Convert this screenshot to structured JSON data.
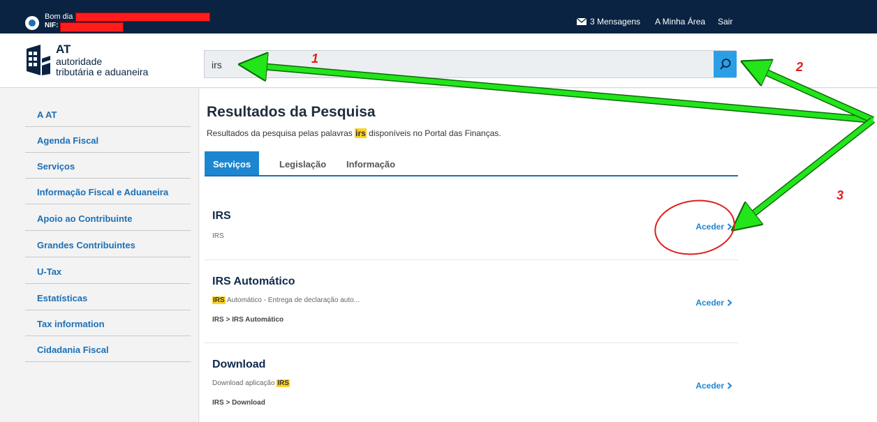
{
  "topbar": {
    "greeting": "Bom dia",
    "nif_label": "NIF:",
    "messages": "3 Mensagens",
    "my_area": "A Minha Área",
    "logout": "Sair"
  },
  "logo": {
    "acronym": "AT",
    "line1": "autoridade",
    "line2": "tributária e aduaneira"
  },
  "search": {
    "value": "irs",
    "icon": "search-icon"
  },
  "sidebar": {
    "items": [
      {
        "label": "A AT"
      },
      {
        "label": "Agenda Fiscal"
      },
      {
        "label": "Serviços"
      },
      {
        "label": "Informação Fiscal e Aduaneira"
      },
      {
        "label": "Apoio ao Contribuinte"
      },
      {
        "label": "Grandes Contribuintes"
      },
      {
        "label": "U-Tax"
      },
      {
        "label": "Estatísticas"
      },
      {
        "label": "Tax information"
      },
      {
        "label": "Cidadania Fiscal"
      }
    ]
  },
  "main": {
    "title": "Resultados da Pesquisa",
    "subtitle_pre": "Resultados da pesquisa pelas palavras ",
    "subtitle_term": "irs",
    "subtitle_post": " disponíveis no Portal das Finanças.",
    "tabs": [
      {
        "label": "Serviços",
        "active": true
      },
      {
        "label": "Legislação",
        "active": false
      },
      {
        "label": "Informação",
        "active": false
      }
    ],
    "results": [
      {
        "title": "IRS",
        "desc_hl": "",
        "desc": "IRS",
        "path": "",
        "action": "Aceder"
      },
      {
        "title": "IRS Automático",
        "desc_hl": "IRS",
        "desc": " Automático - Entrega de declaração auto...",
        "path": "IRS > IRS Automático",
        "action": "Aceder"
      },
      {
        "title": "Download",
        "desc_hl": "IRS",
        "desc": "Download aplicação ",
        "path": "IRS > Download",
        "action": "Aceder"
      }
    ]
  },
  "annotations": {
    "n1": "1",
    "n2": "2",
    "n3": "3",
    "arrow_color": "#22e51a",
    "circle_color": "#e01e1e"
  }
}
